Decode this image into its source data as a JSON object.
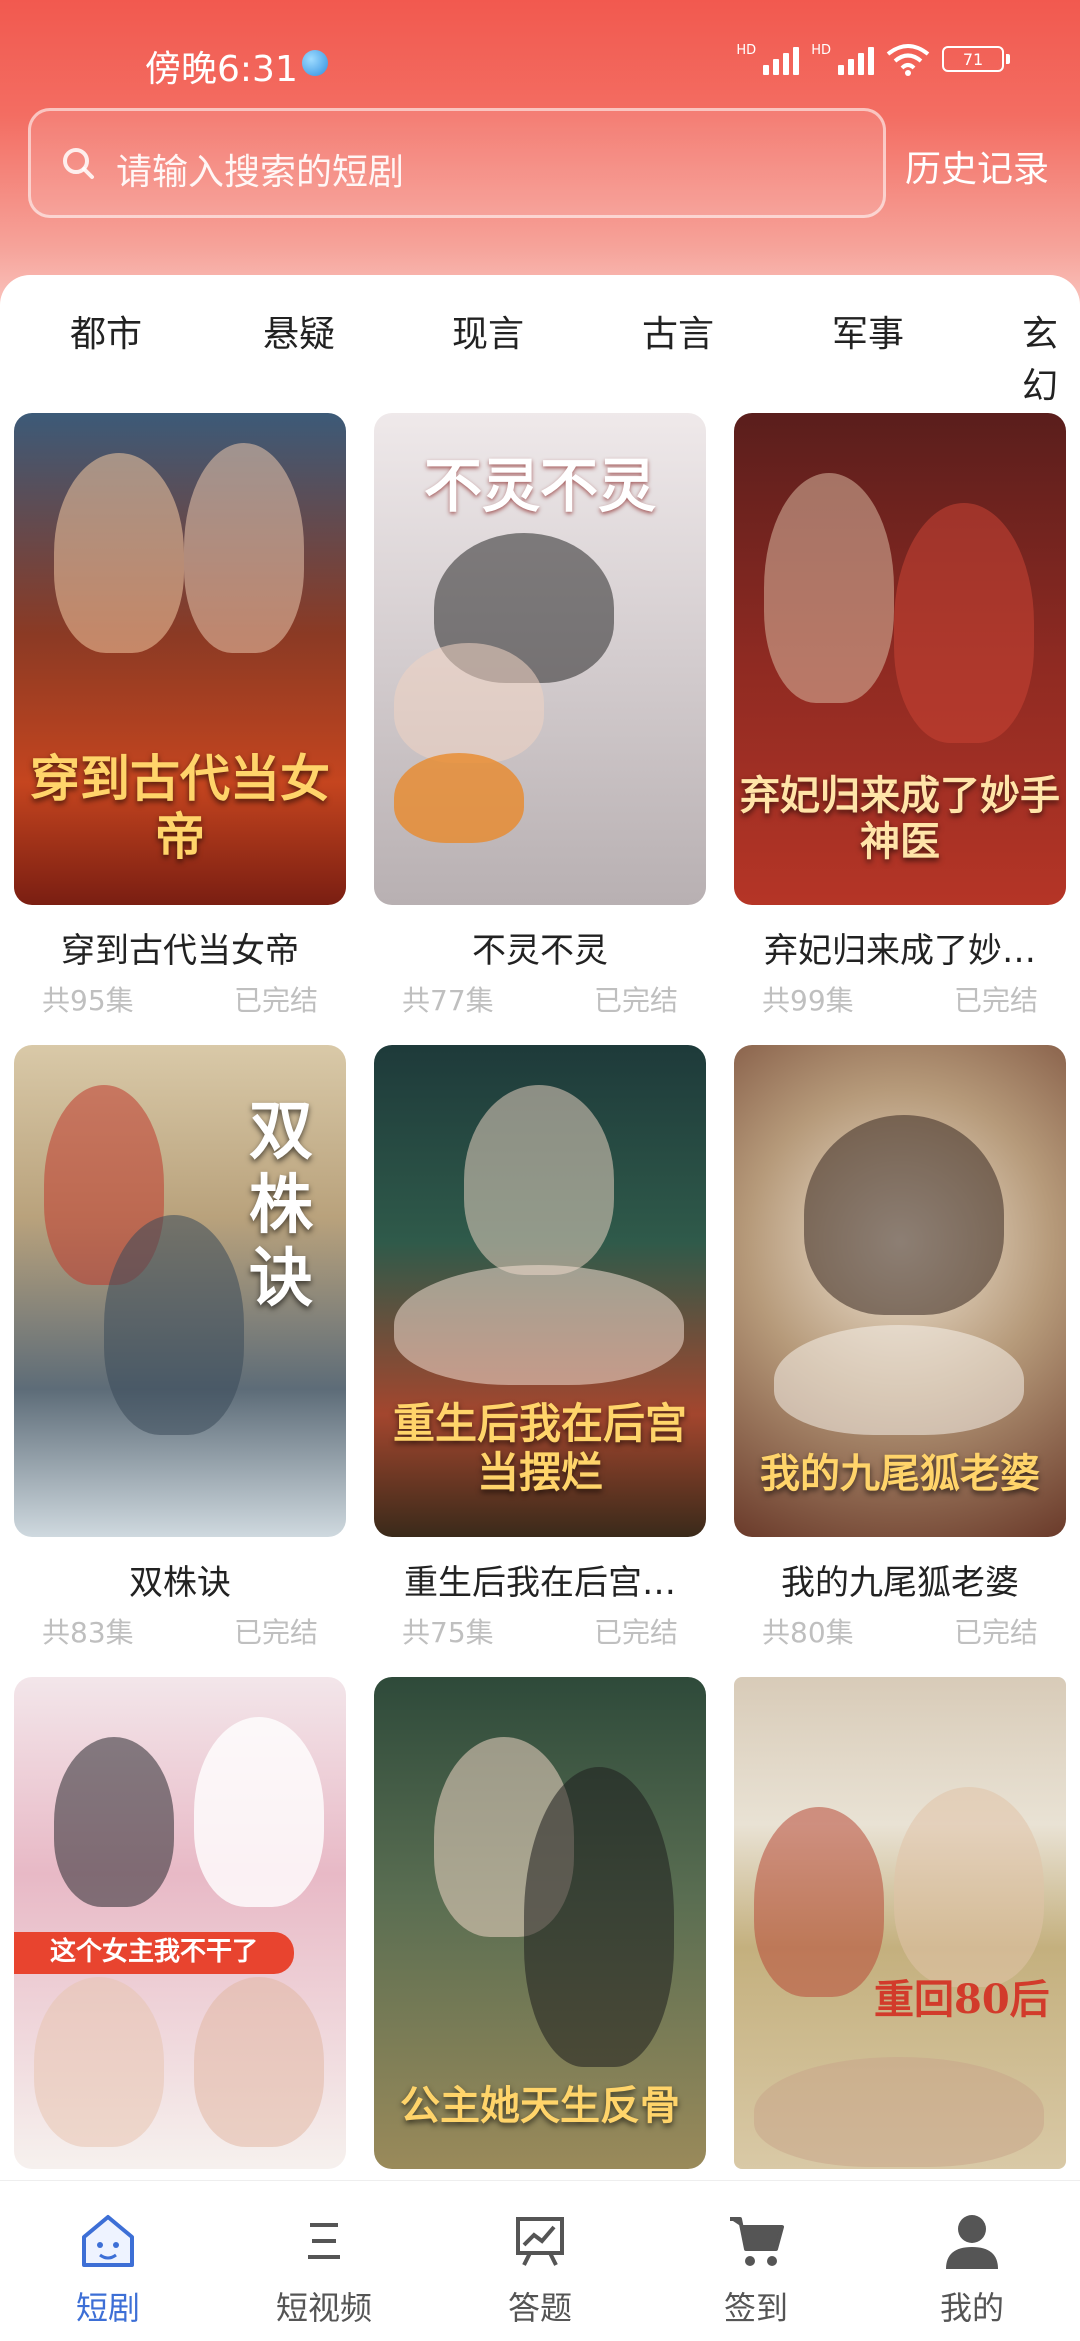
{
  "status_bar": {
    "time": "傍晚6:31",
    "battery": "71",
    "signal_label": "HD"
  },
  "search": {
    "placeholder": "请输入搜索的短剧",
    "history_label": "历史记录"
  },
  "tabs": [
    "都市",
    "悬疑",
    "现言",
    "古言",
    "军事",
    "玄幻"
  ],
  "dramas": [
    {
      "title": "穿到古代当女帝",
      "episodes": "共95集",
      "status": "已完结",
      "poster_text": "穿到古代当女帝"
    },
    {
      "title": "不灵不灵",
      "episodes": "共77集",
      "status": "已完结",
      "poster_text": "不灵不灵"
    },
    {
      "title": "弃妃归来成了妙…",
      "episodes": "共99集",
      "status": "已完结",
      "poster_text": "弃妃归来成了妙手神医"
    },
    {
      "title": "双株诀",
      "episodes": "共83集",
      "status": "已完结",
      "poster_text": "双株诀"
    },
    {
      "title": "重生后我在后宫…",
      "episodes": "共75集",
      "status": "已完结",
      "poster_text": "重生后我在后宫当摆烂"
    },
    {
      "title": "我的九尾狐老婆",
      "episodes": "共80集",
      "status": "已完结",
      "poster_text": "我的九尾狐老婆"
    },
    {
      "poster_text": "这个女主我不干了"
    },
    {
      "poster_text": "公主她天生反骨"
    },
    {
      "poster_text": "重回80后"
    }
  ],
  "bottom_nav": [
    {
      "label": "短剧",
      "icon": "home-icon",
      "active": true
    },
    {
      "label": "短视频",
      "icon": "menu-icon",
      "active": false
    },
    {
      "label": "答题",
      "icon": "chart-board-icon",
      "active": false
    },
    {
      "label": "签到",
      "icon": "cart-icon",
      "active": false
    },
    {
      "label": "我的",
      "icon": "user-icon",
      "active": false
    }
  ],
  "colors": {
    "accent": "#3d6fd6",
    "header": "#f2594f",
    "muted": "#bfbfbf"
  }
}
